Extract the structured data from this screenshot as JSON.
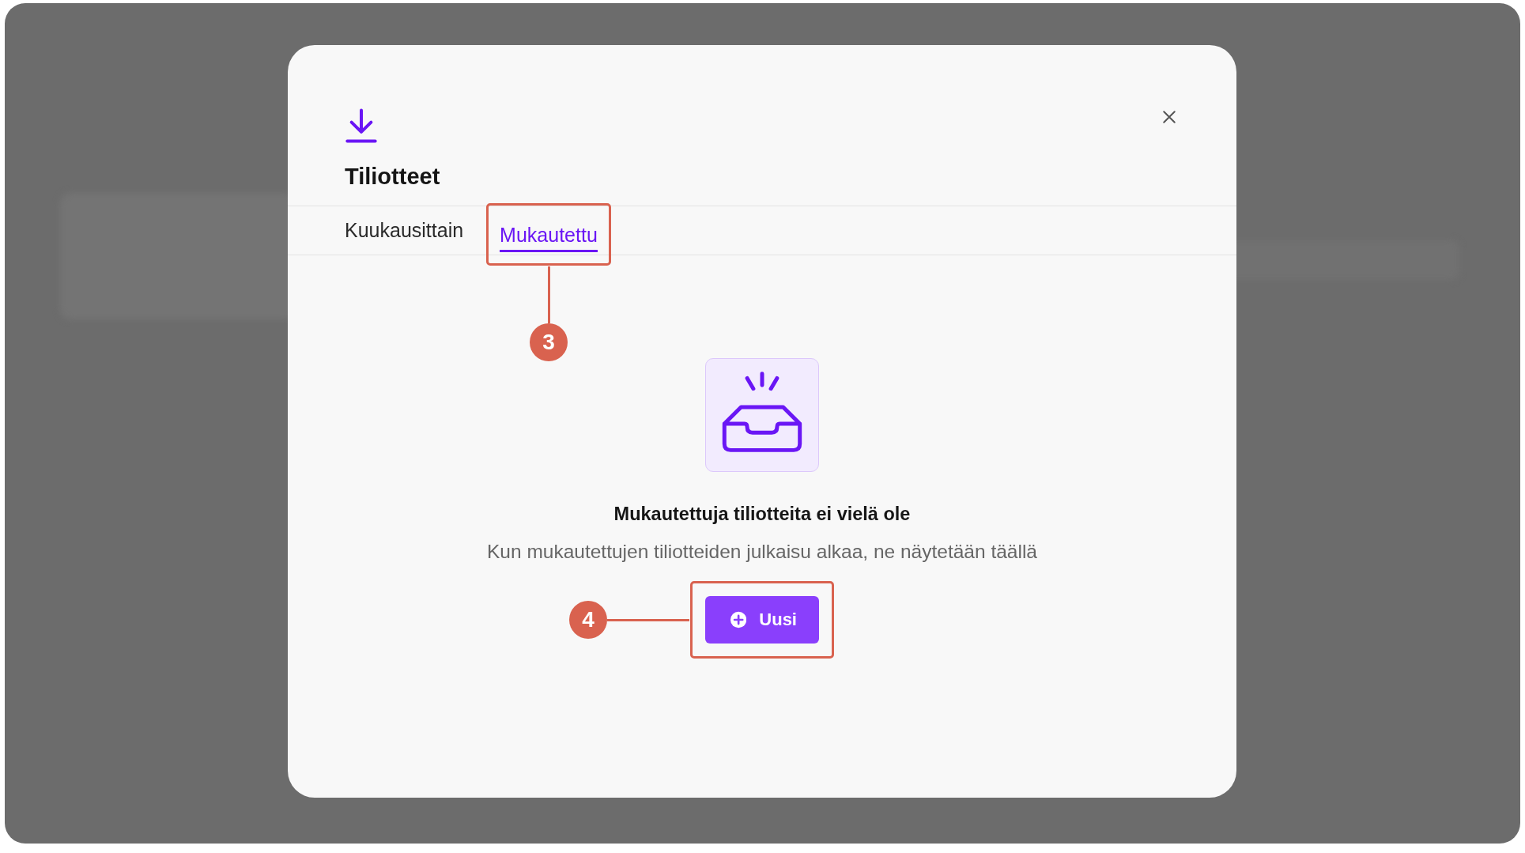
{
  "dialog": {
    "title": "Tiliotteet"
  },
  "tabs": [
    {
      "label": "Kuukausittain",
      "selected": false
    },
    {
      "label": "Mukautettu",
      "selected": true,
      "annotation": "3"
    }
  ],
  "empty_state": {
    "heading": "Mukautettuja tiliotteita ei vielä ole",
    "description": "Kun mukautettujen tiliotteiden julkaisu alkaa, ne näytetään täällä"
  },
  "new_button": {
    "label": "Uusi",
    "annotation": "4"
  }
}
